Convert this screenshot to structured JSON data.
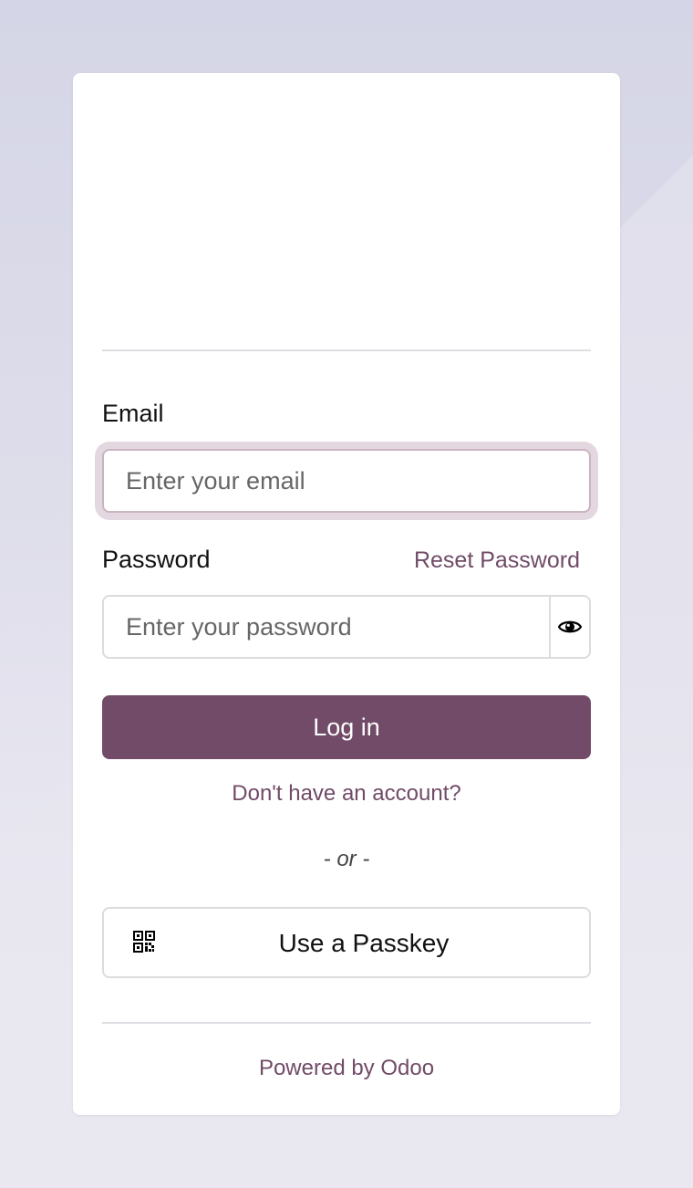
{
  "form": {
    "email_label": "Email",
    "email_placeholder": "Enter your email",
    "password_label": "Password",
    "reset_password_link": "Reset Password",
    "password_placeholder": "Enter your password",
    "show_password_icon": "eye-icon",
    "login_button": "Log in",
    "signup_link": "Don't have an account?",
    "separator": "- or -",
    "passkey_icon": "qr-code-icon",
    "passkey_button": "Use a Passkey"
  },
  "footer": {
    "powered_by": "Powered by Odoo"
  },
  "colors": {
    "brand": "#714b67",
    "background": "#d4d5e6",
    "card": "#ffffff"
  }
}
